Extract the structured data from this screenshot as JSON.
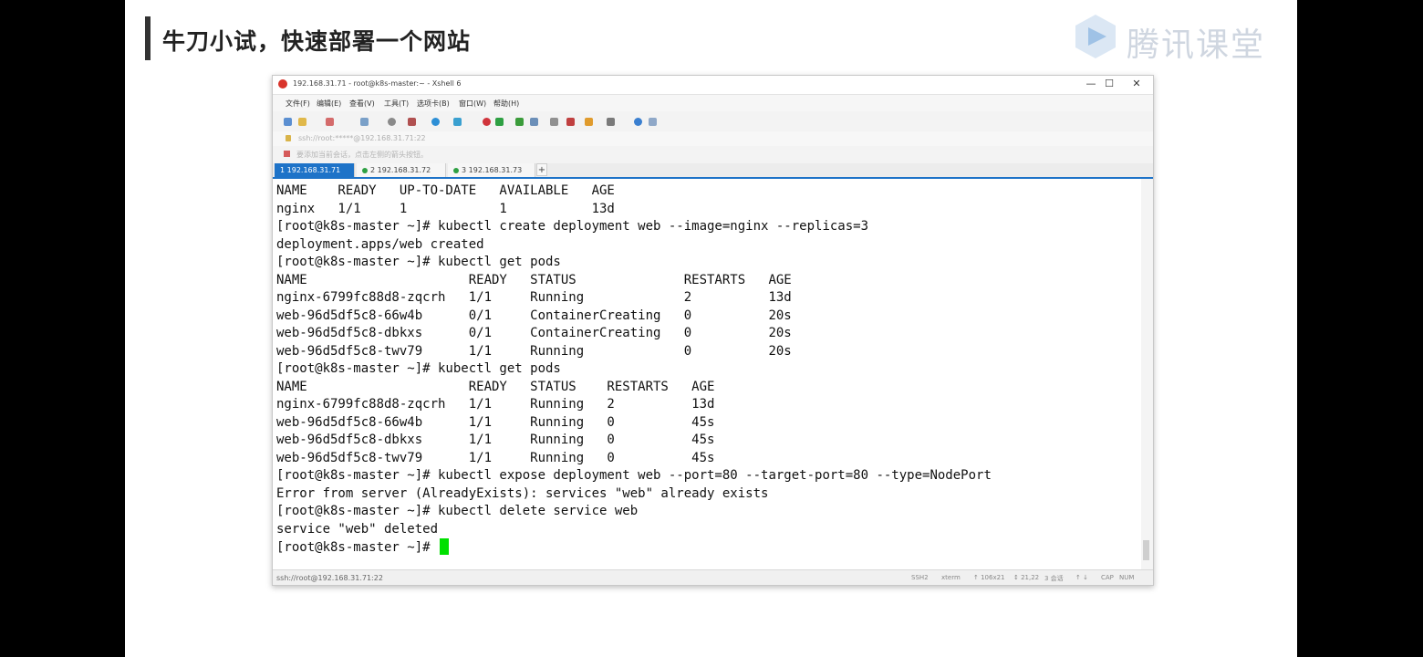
{
  "slide": {
    "title": "牛刀小试，快速部署一个网站",
    "brand": "腾讯课堂"
  },
  "window": {
    "title": "192.168.31.71 - root@k8s-master:~ - Xshell 6",
    "minimize": "—",
    "maximize": "☐",
    "close": "✕"
  },
  "menu": [
    "文件(F)",
    "编辑(E)",
    "查看(V)",
    "工具(T)",
    "选项卡(B)",
    "窗口(W)",
    "帮助(H)"
  ],
  "toolbar": {
    "icons": [
      "new-session-icon",
      "open-folder-icon",
      "disconnect-icon",
      "copy-icon",
      "find-icon",
      "properties-icon",
      "globe-icon",
      "color-icon",
      "xftp-icon",
      "fullscreen-icon",
      "lock-icon",
      "keyboard-icon",
      "script-icon",
      "help-icon"
    ],
    "colors": {
      "accent": "#1e73c8",
      "red": "#d9342b",
      "green": "#2ea043",
      "orange": "#e09b2d"
    }
  },
  "address": {
    "value": "ssh://root:*****@192.168.31.71:22"
  },
  "hint": {
    "text": "要添加当前会话，点击左侧的箭头按钮。"
  },
  "tabs": [
    {
      "label": "1 192.168.31.71",
      "active": true
    },
    {
      "label": "2 192.168.31.72",
      "active": false
    },
    {
      "label": "3 192.168.31.73",
      "active": false
    }
  ],
  "tab_add": "+",
  "terminal": {
    "lines": [
      "NAME    READY   UP-TO-DATE   AVAILABLE   AGE",
      "nginx   1/1     1            1           13d",
      "[root@k8s-master ~]# kubectl create deployment web --image=nginx --replicas=3",
      "deployment.apps/web created",
      "[root@k8s-master ~]# kubectl get pods",
      "NAME                     READY   STATUS              RESTARTS   AGE",
      "nginx-6799fc88d8-zqcrh   1/1     Running             2          13d",
      "web-96d5df5c8-66w4b      0/1     ContainerCreating   0          20s",
      "web-96d5df5c8-dbkxs      0/1     ContainerCreating   0          20s",
      "web-96d5df5c8-twv79      1/1     Running             0          20s",
      "[root@k8s-master ~]# kubectl get pods",
      "NAME                     READY   STATUS    RESTARTS   AGE",
      "nginx-6799fc88d8-zqcrh   1/1     Running   2          13d",
      "web-96d5df5c8-66w4b      1/1     Running   0          45s",
      "web-96d5df5c8-dbkxs      1/1     Running   0          45s",
      "web-96d5df5c8-twv79      1/1     Running   0          45s",
      "[root@k8s-master ~]# kubectl expose deployment web --port=80 --target-port=80 --type=NodePort",
      "Error from server (AlreadyExists): services \"web\" already exists",
      "[root@k8s-master ~]# kubectl delete service web",
      "service \"web\" deleted"
    ],
    "prompt": "[root@k8s-master ~]# "
  },
  "status": {
    "connection": "ssh://root@192.168.31.71:22",
    "items": [
      "SSH2",
      "xterm",
      "↑ 106x21",
      "↕ 21,22",
      "3 会话",
      "↑ ↓",
      "CAP",
      "NUM"
    ]
  }
}
